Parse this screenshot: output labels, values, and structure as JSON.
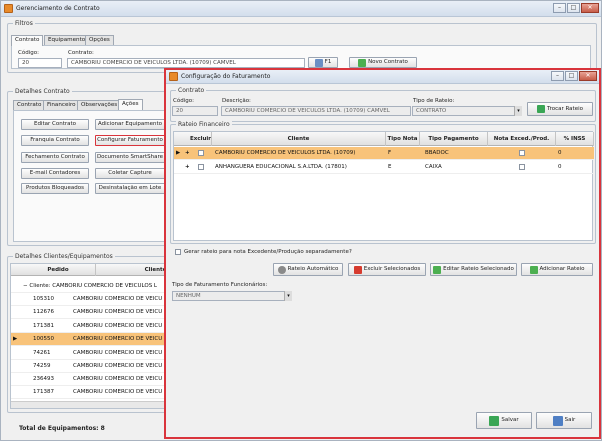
{
  "main_window": {
    "title": "Gerenciamento de Contrato"
  },
  "filtros": {
    "legend": "Filtros",
    "tabs": [
      "Contrato",
      "Equipamento",
      "Opções"
    ],
    "codigo_label": "Código:",
    "codigo_value": "20",
    "contrato_label": "Contrato:",
    "contrato_value": "CAMBORIU COMERCIO DE VEICULOS LTDA. (10709) CAMVEL",
    "f1_label": "F1",
    "novo_contrato": "Novo Contrato"
  },
  "detalhes": {
    "legend": "Detalhes Contrato",
    "tabs": [
      "Contrato",
      "Financeiro",
      "Observações",
      "Ações"
    ],
    "acoes": [
      "Editar Contrato",
      "Adicionar Equipamento",
      "Franquia Contrato",
      "Configurar Faturamento",
      "Fechamento Contrato",
      "Documento SmartShare",
      "E-mail Contadores",
      "Coletar Capture",
      "Produtos Bloqueados",
      "Desinstalação em Lote"
    ]
  },
  "clientes": {
    "legend": "Detalhes Clientes/Equipamentos",
    "col_pedido": "Pedido",
    "col_cliente": "Cliente",
    "group": "Cliente: CAMBORIU COMERCIO DE VEICULOS L",
    "rows": [
      {
        "pedido": "105310",
        "cliente": "CAMBORIU COMERCIO DE VEICU"
      },
      {
        "pedido": "112676",
        "cliente": "CAMBORIU COMERCIO DE VEICU"
      },
      {
        "pedido": "171381",
        "cliente": "CAMBORIU COMERCIO DE VEICU"
      },
      {
        "pedido": "100550",
        "cliente": "CAMBORIU COMERCIO DE VEICU"
      },
      {
        "pedido": "74261",
        "cliente": "CAMBORIU COMERCIO DE VEICU"
      },
      {
        "pedido": "74259",
        "cliente": "CAMBORIU COMERCIO DE VEICU"
      },
      {
        "pedido": "236493",
        "cliente": "CAMBORIU COMERCIO DE VEICU"
      },
      {
        "pedido": "171387",
        "cliente": "CAMBORIU COMERCIO DE VEICU"
      }
    ],
    "total": "Total de Equipamentos: 8"
  },
  "dialog": {
    "title": "Configuração do Faturamento",
    "contrato_legend": "Contrato",
    "codigo_label": "Código:",
    "codigo_value": "20",
    "descricao_label": "Descrição:",
    "descricao_value": "CAMBORIU COMERCIO DE VEICULOS LTDA. (10709) CAMVEL",
    "tipo_rateio_label": "Tipo de Rateio:",
    "tipo_rateio_value": "CONTRATO",
    "trocar_rateio": "Trocar Rateio",
    "rateio_legend": "Rateio Financeiro",
    "cols": {
      "excluir": "Excluir",
      "cliente": "Cliente",
      "tipo_nota": "Tipo Nota",
      "tipo_pagamento": "Tipo Pagamento",
      "nota_exced": "Nota Exced./Prod.",
      "inss": "% INSS"
    },
    "rows": [
      {
        "cliente": "CAMBORIU COMERCIO DE VEICULOS LTDA. (10709)",
        "tipo_nota": "F",
        "tipo_pagamento": "BBADOC",
        "inss": "0"
      },
      {
        "cliente": "ANHANGUERA EDUCACIONAL S.A.LTDA. (17801)",
        "tipo_nota": "E",
        "tipo_pagamento": "CAIXA",
        "inss": "0"
      }
    ],
    "gerar_rateio": "Gerar rateio para nota Excedente/Produção separadamente?",
    "btn_rateio_auto": "Rateio Automático",
    "btn_excluir": "Excluir Selecionados",
    "btn_editar": "Editar Rateio Selecionado",
    "btn_adicionar": "Adicionar Rateio",
    "tipo_fat_label": "Tipo de Faturamento Funcionários:",
    "tipo_fat_value": "NENHUM",
    "salvar": "Salvar",
    "sair": "Sair"
  },
  "colors": {
    "highlight_border": "#d9343c",
    "selected_row": "#f8c37a"
  }
}
